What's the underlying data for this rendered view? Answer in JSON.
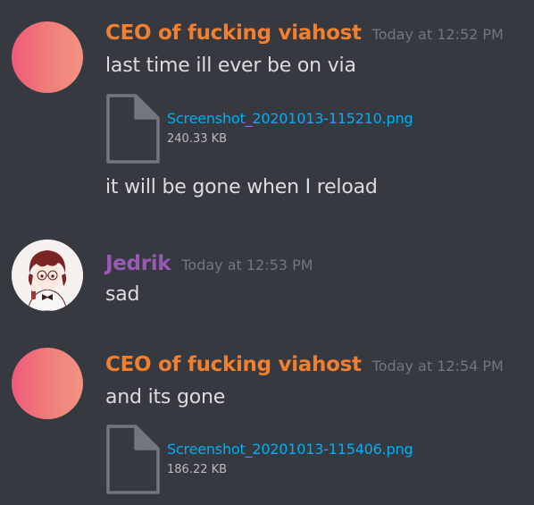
{
  "messages": [
    {
      "author": "CEO of fucking viahost",
      "timestamp": "Today at 12:52 PM",
      "lines": [
        "last time ill ever be on via",
        "it will be gone when I reload"
      ],
      "attachment": {
        "file_name": "Screenshot_20201013-115210.png",
        "file_size": "240.33 KB"
      },
      "author_color": "#f07f30"
    },
    {
      "author": "Jedrik",
      "timestamp": "Today at 12:53 PM",
      "lines": [
        "sad"
      ],
      "author_color": "#9b59b6"
    },
    {
      "author": "CEO of fucking viahost",
      "timestamp": "Today at 12:54 PM",
      "lines": [
        "and its gone"
      ],
      "attachment": {
        "file_name": "Screenshot_20201013-115406.png",
        "file_size": "186.22 KB"
      },
      "author_color": "#f07f30"
    }
  ],
  "colors": {
    "background": "#36393f",
    "link": "#00aff4",
    "muted": "#72767d",
    "text": "#dcddde"
  },
  "icons": {
    "file": "file-icon",
    "avatar_default": "gradient-avatar",
    "avatar_jedrik": "anime-character-avatar"
  }
}
